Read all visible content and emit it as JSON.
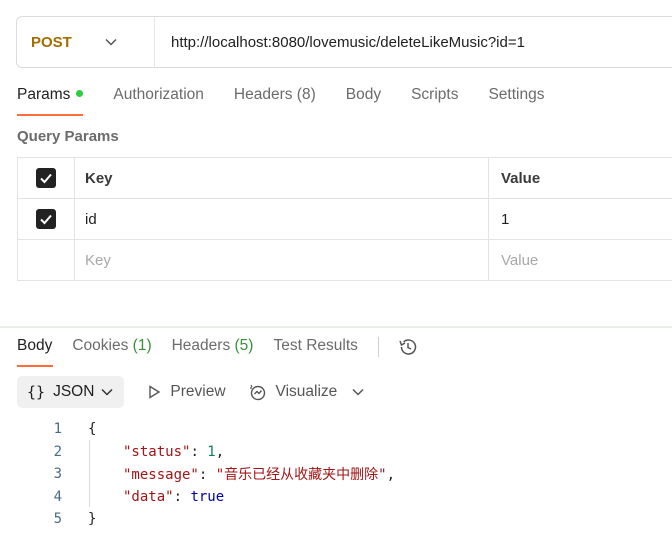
{
  "request": {
    "method": "POST",
    "url": "http://localhost:8080/lovemusic/deleteLikeMusic?id=1"
  },
  "request_tabs": [
    {
      "label": "Params",
      "active": true
    },
    {
      "label": "Authorization"
    },
    {
      "label": "Headers (8)"
    },
    {
      "label": "Body"
    },
    {
      "label": "Scripts"
    },
    {
      "label": "Settings"
    }
  ],
  "query_params": {
    "title": "Query Params",
    "header": {
      "key": "Key",
      "value": "Value"
    },
    "rows": [
      {
        "key": "id",
        "value": "1",
        "checked": true
      }
    ],
    "placeholder": {
      "key": "Key",
      "value": "Value"
    }
  },
  "response_tabs": {
    "body": "Body",
    "cookies": "Cookies",
    "cookies_count": "(1)",
    "headers": "Headers",
    "headers_count": "(5)",
    "test_results": "Test Results"
  },
  "toolbar": {
    "format_braces": "{}",
    "format_label": "JSON",
    "preview": "Preview",
    "visualize": "Visualize"
  },
  "response_body": {
    "line_numbers": [
      "1",
      "2",
      "3",
      "4",
      "5"
    ],
    "open_brace": "{",
    "close_brace": "}",
    "status_key": "\"status\"",
    "status_value": "1",
    "message_key": "\"message\"",
    "message_value": "\"音乐已经从收藏夹中删除\"",
    "data_key": "\"data\"",
    "data_value": "true"
  },
  "colors": {
    "method": "#a36d00",
    "accent": "#ff6c37",
    "active_dot": "#2ecc40",
    "count": "#3a8f3a"
  }
}
